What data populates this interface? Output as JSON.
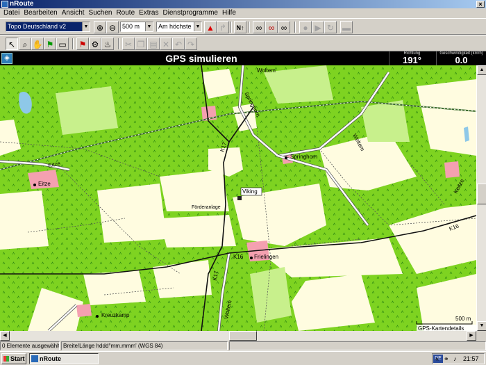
{
  "window": {
    "title": "nRoute"
  },
  "menu": [
    "Datei",
    "Bearbeiten",
    "Ansicht",
    "Suchen",
    "Route",
    "Extras",
    "Dienstprogramme",
    "Hilfe"
  ],
  "toolbar": {
    "map_product": "Topo Deutschland v2",
    "zoom_scale": "500 m",
    "detail_level": "Am höchste"
  },
  "gps": {
    "title": "GPS simulieren",
    "heading_label": "Richtung",
    "heading_value": "191°",
    "speed_label": "Geschwindigkeit (km/h)",
    "speed_value": "0.0"
  },
  "map": {
    "labels": {
      "woltem_top": "Woltem",
      "springhorn_road": "Springhorn",
      "k17_a": "K17",
      "springhorn": "Springhorn",
      "woltem_right": "Woltem",
      "eitze_road": "Eitze",
      "eitze": "Eitze",
      "viking": "Viking",
      "foerderanlage": "Förderanlage",
      "k16_right": "K16",
      "k16_left": "K16",
      "frielingen": "Frielingen",
      "k17_b": "K17",
      "woltem_bottom": "Woltem",
      "kreuzkamp": "Kreuzkamp",
      "keitze": "Keitze",
      "scale": "500 m",
      "details": "GPS-Kartendetails"
    }
  },
  "status": {
    "selection": "0 Elemente ausgewählt",
    "coords": "Breite/Länge hddd°mm.mmm' (WGS 84)"
  },
  "taskbar": {
    "start": "Start",
    "task": "nRoute",
    "lang": "DE",
    "clock": "21:57"
  }
}
